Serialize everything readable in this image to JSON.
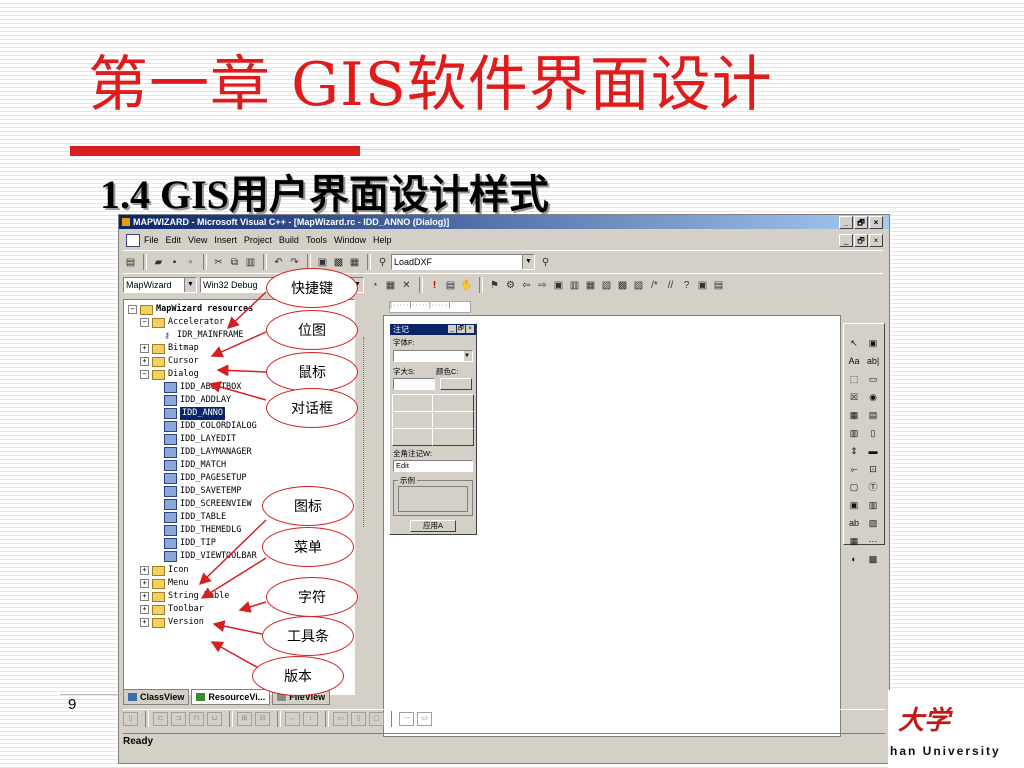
{
  "slide": {
    "title": "第一章 GIS软件界面设计",
    "subtitle": "1.4 GIS用户界面设计样式",
    "page_number": "9",
    "logo_cn": "大学",
    "logo_en": "han University"
  },
  "window": {
    "title": "MAPWIZARD - Microsoft Visual C++ - [MapWizard.rc - IDD_ANNO (Dialog)]",
    "controls": [
      "_",
      "🗗",
      "×"
    ],
    "menu": [
      "File",
      "Edit",
      "View",
      "Insert",
      "Project",
      "Build",
      "Tools",
      "Window",
      "Help"
    ],
    "find_combo": "LoadDXF",
    "project_combo": "MapWizard",
    "config_combo": "Win32 Debug",
    "status": "Ready"
  },
  "tree": {
    "root": "MapWizard resources",
    "accelerator": "Accelerator",
    "accel_item": "IDR_MAINFRAME",
    "bitmap": "Bitmap",
    "cursor": "Cursor",
    "dialog": "Dialog",
    "dialogs": [
      "IDD_ABOUTBOX",
      "IDD_ADDLAY",
      "IDD_ANNO",
      "IDD_COLORDIALOG",
      "IDD_LAYEDIT",
      "IDD_LAYMANAGER",
      "IDD_MATCH",
      "IDD_PAGESETUP",
      "IDD_SAVETEMP",
      "IDD_SCREENVIEW",
      "IDD_TABLE",
      "IDD_THEMEDLG",
      "IDD_TIP",
      "IDD_VIEWTOOLBAR"
    ],
    "icon": "Icon",
    "menu": "Menu",
    "string_table": "String Table",
    "toolbar": "Toolbar",
    "version": "Version"
  },
  "tabs": [
    "ClassView",
    "ResourceVi...",
    "FileView"
  ],
  "dialog": {
    "title": "注记",
    "font_label": "字体F:",
    "size_label": "字大S:",
    "color_label": "颜色C:",
    "angle_label": "全角注记W:",
    "edit_value": "Edit",
    "group_label": "示例",
    "apply_button": "应用A"
  },
  "callouts": {
    "accelerator": "快捷键",
    "bitmap": "位图",
    "cursor": "鼠标",
    "dialog": "对话框",
    "icon": "图标",
    "menu": "菜单",
    "string": "字符",
    "toolbar": "工具条",
    "version": "版本"
  },
  "palette": [
    "↖",
    "▣",
    "Aa",
    "ab|",
    "⬚",
    "▭",
    "☒",
    "◉",
    "▦",
    "▤",
    "▥",
    "▯",
    "⇕",
    "▬",
    "⟜",
    "⊡",
    "▢",
    "Ⓣ",
    "▣",
    "▥",
    "ab",
    "▨",
    "▦",
    "⋯",
    "◐",
    "▩"
  ],
  "colors": {
    "accent": "#e01b1b",
    "titlebar": "#0a246a"
  }
}
